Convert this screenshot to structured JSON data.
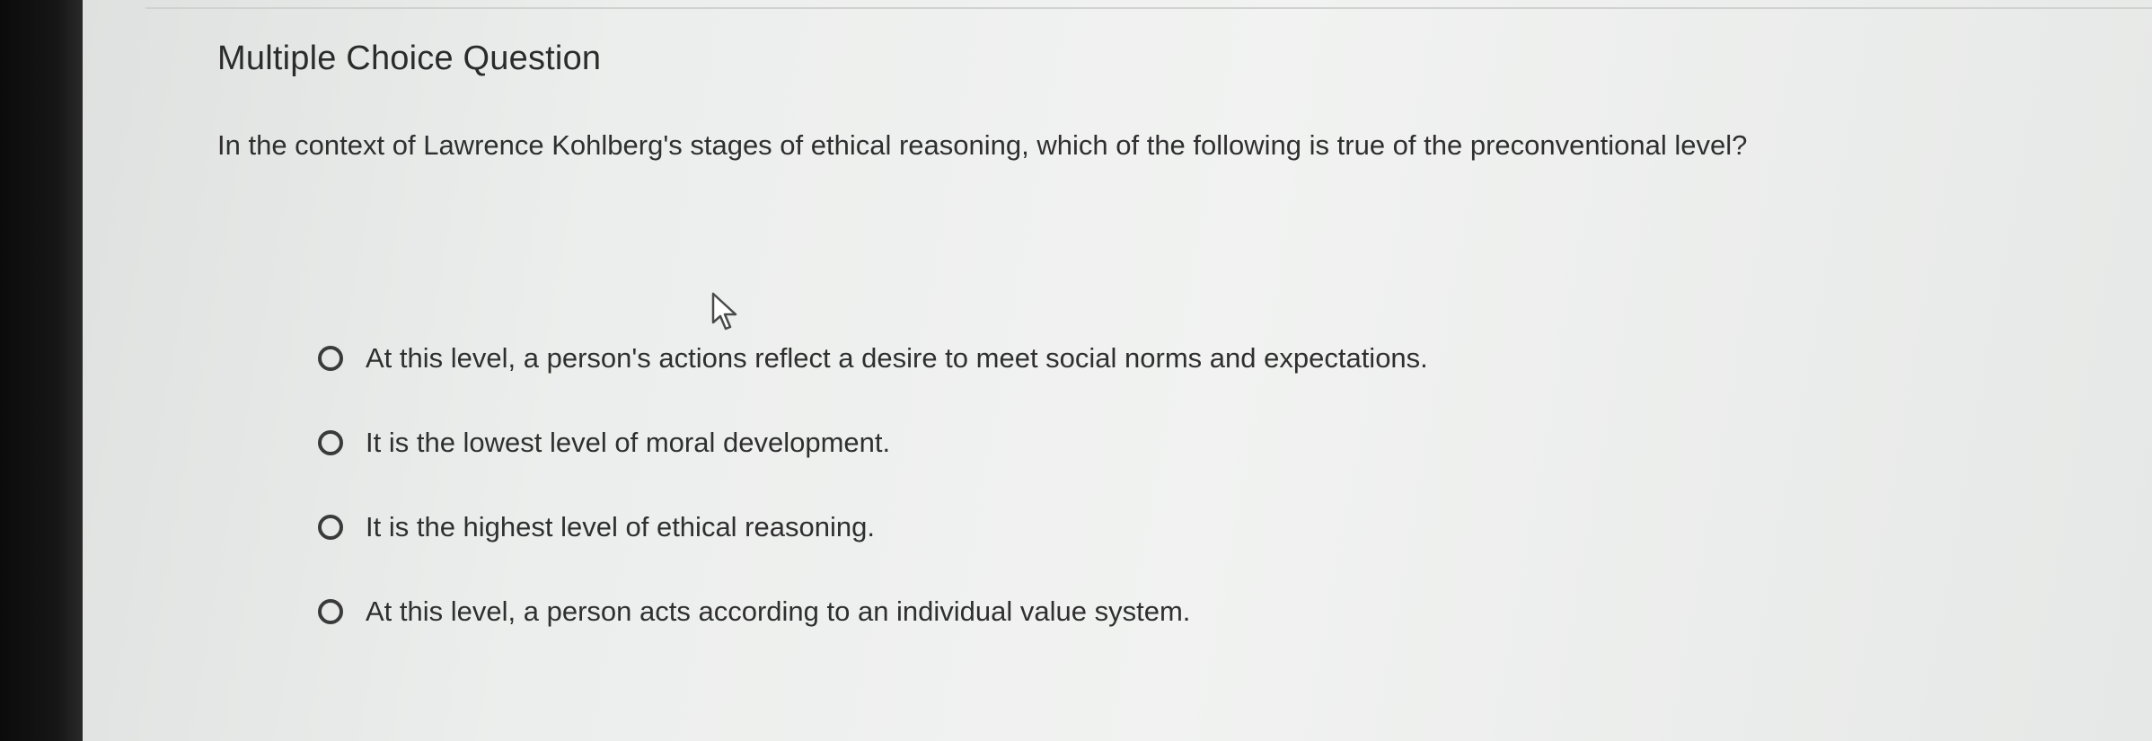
{
  "question": {
    "type_label": "Multiple Choice Question",
    "prompt": "In the context of Lawrence Kohlberg's stages of ethical reasoning, which of the following is true of the preconventional level?"
  },
  "options": [
    {
      "label": "At this level, a person's actions reflect a desire to meet social norms and expectations.",
      "selected": false
    },
    {
      "label": "It is the lowest level of moral development.",
      "selected": false
    },
    {
      "label": "It is the highest level of ethical reasoning.",
      "selected": false
    },
    {
      "label": "At this level, a person acts according to an individual value system.",
      "selected": false
    }
  ],
  "icons": {
    "radio": "radio-unselected-icon",
    "cursor": "mouse-pointer-icon"
  },
  "colors": {
    "text": "#2f2f2f",
    "radio_border": "#3a3a3a",
    "background": "#eceeed"
  }
}
